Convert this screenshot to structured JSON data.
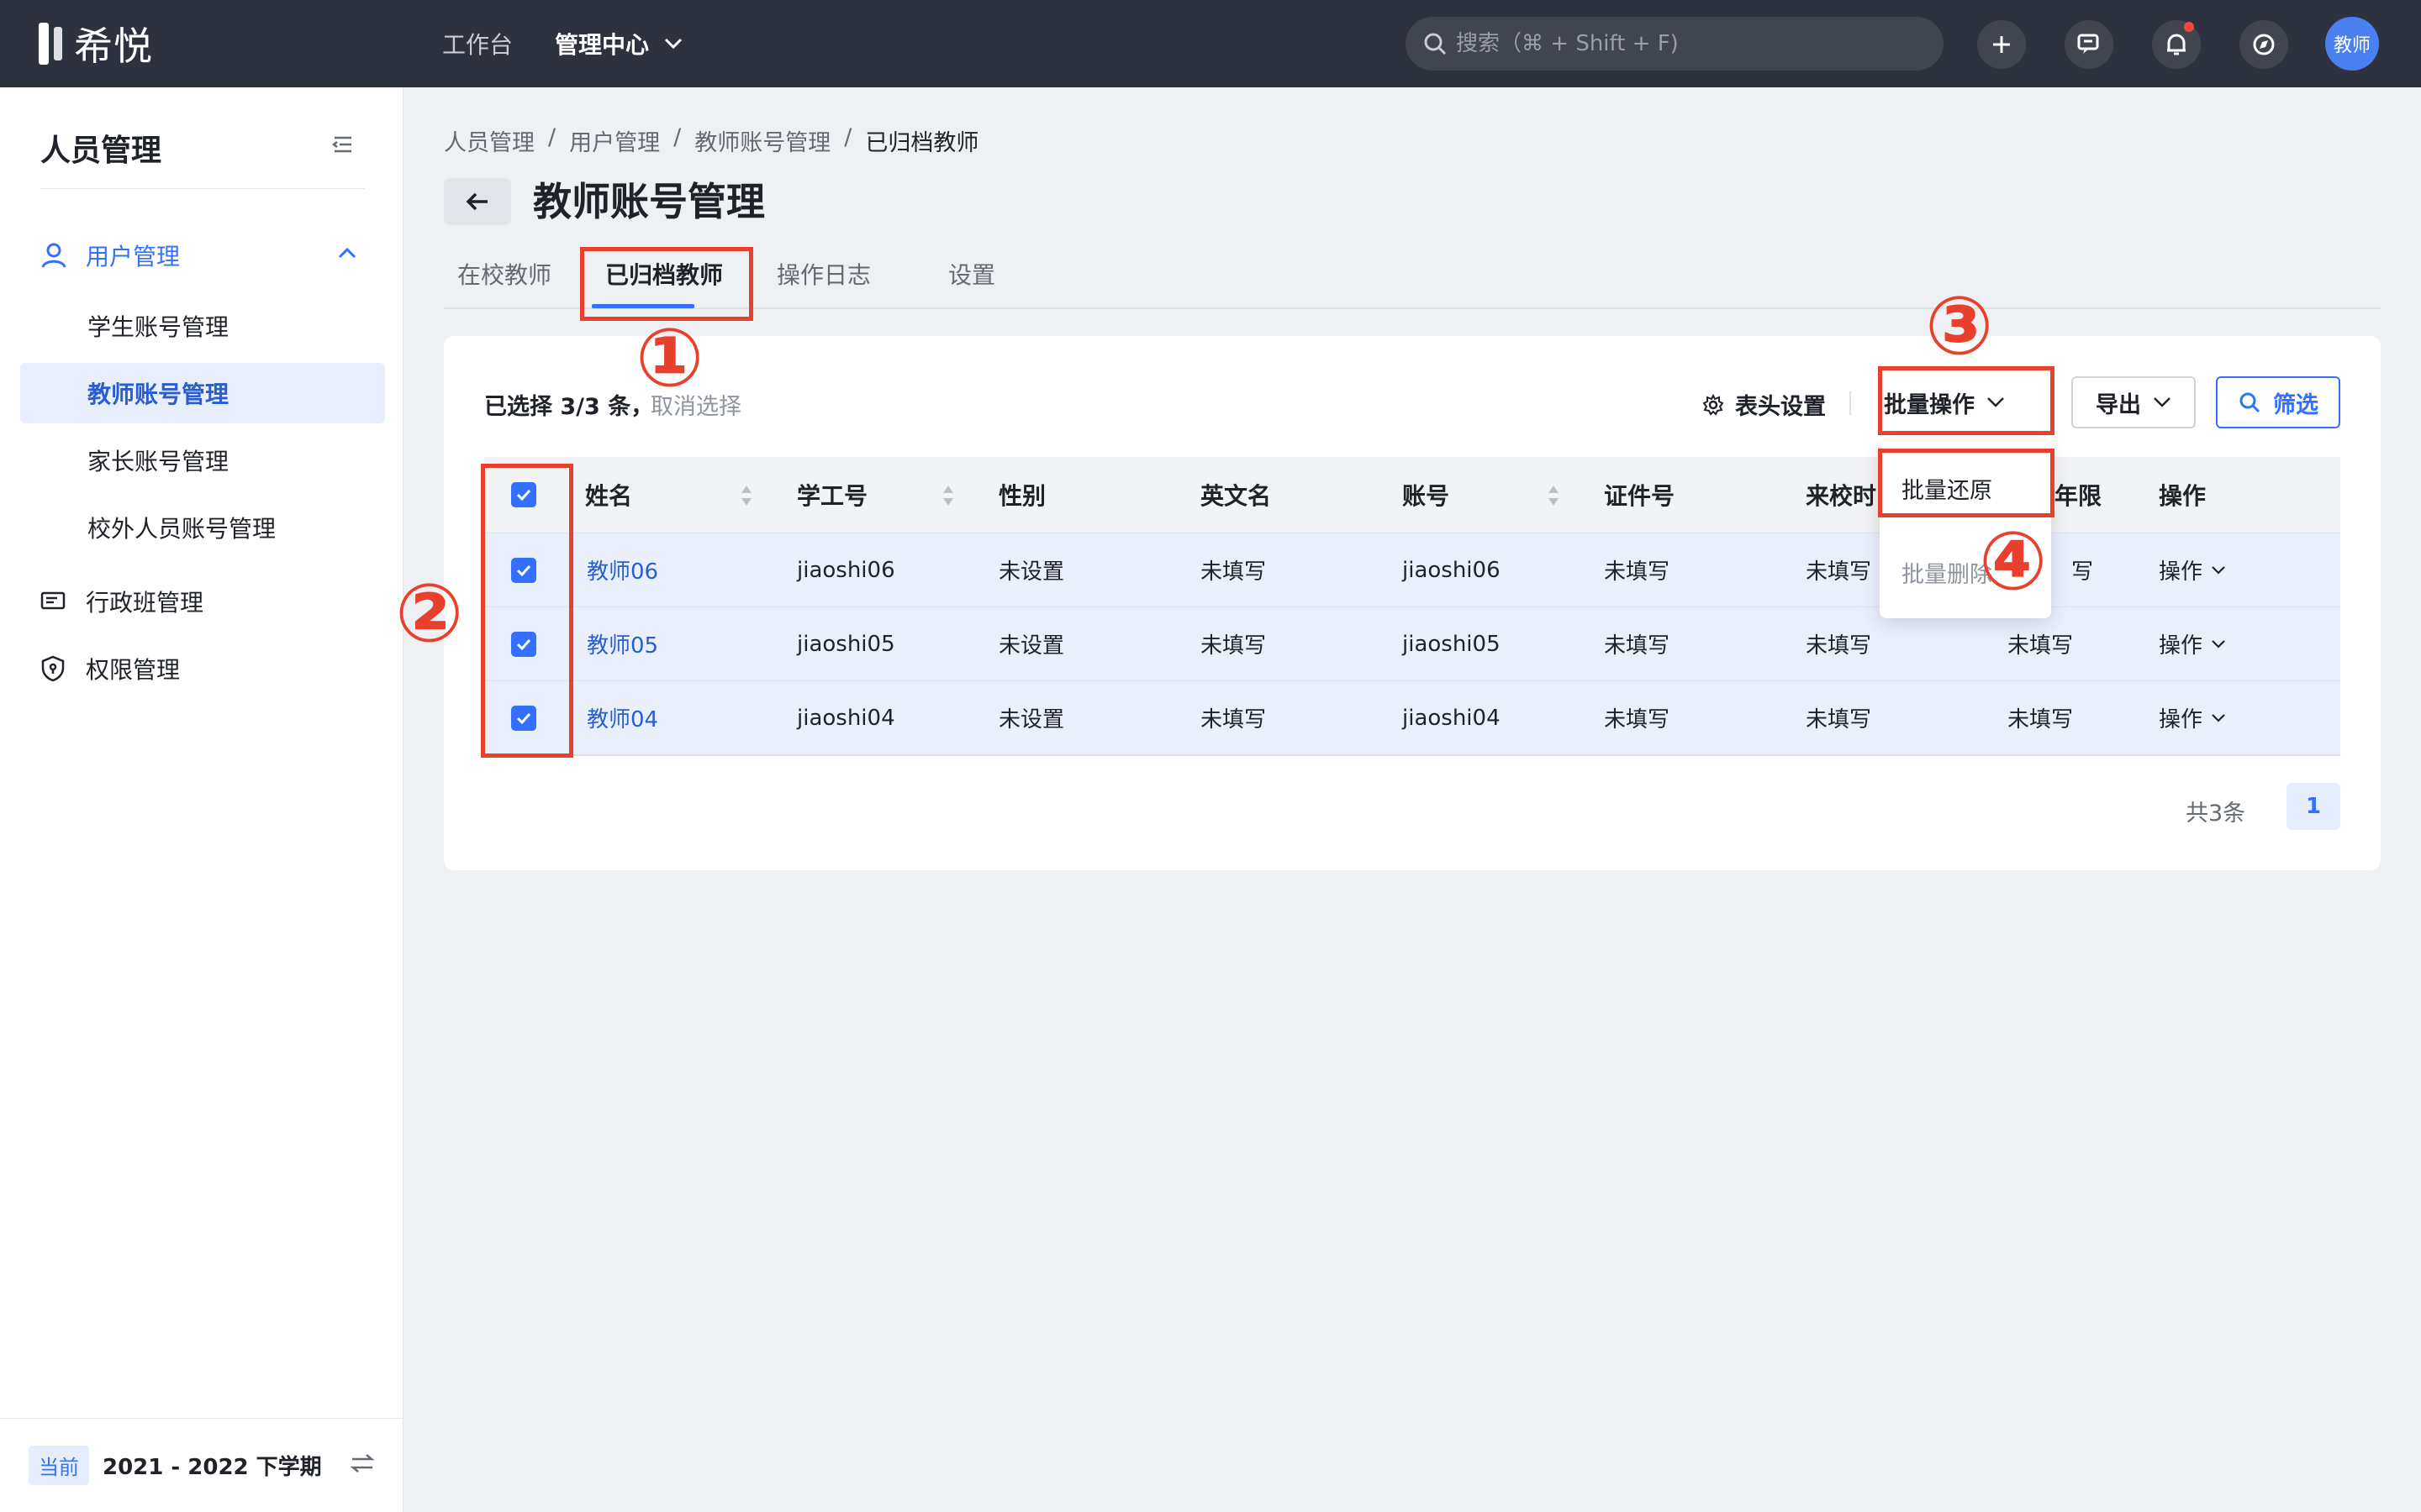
{
  "topbar": {
    "logo_text": "希悦",
    "nav": [
      "工作台",
      "管理中心"
    ],
    "search_placeholder": "搜索（⌘ + Shift + F)",
    "avatar_text": "教师"
  },
  "sidebar": {
    "title": "人员管理",
    "group_label": "用户管理",
    "items": [
      "学生账号管理",
      "教师账号管理",
      "家长账号管理",
      "校外人员账号管理"
    ],
    "other_items": [
      "行政班管理",
      "权限管理"
    ],
    "term_tag": "当前",
    "term_text": "2021 - 2022 下学期"
  },
  "breadcrumb": [
    "人员管理",
    "用户管理",
    "教师账号管理",
    "已归档教师"
  ],
  "breadcrumb_sep": "/",
  "page_title": "教师账号管理",
  "tabs": [
    "在校教师",
    "已归档教师",
    "操作日志",
    "设置"
  ],
  "toolbar": {
    "selected_text": "已选择 3/3 条，",
    "cancel_select": "取消选择",
    "header_settings": "表头设置",
    "batch_ops": "批量操作",
    "export": "导出",
    "filter": "筛选"
  },
  "dropdown": {
    "items": [
      "批量还原",
      "批量删除"
    ]
  },
  "table": {
    "headers": [
      "姓名",
      "学工号",
      "性别",
      "英文名",
      "账号",
      "证件号",
      "来校时",
      "年限",
      "操作"
    ],
    "rows": [
      {
        "name": "教师06",
        "id": "jiaoshi06",
        "gender": "未设置",
        "en": "未填写",
        "account": "jiaoshi06",
        "cert": "未填写",
        "join": "未填写",
        "years": "写",
        "op": "操作"
      },
      {
        "name": "教师05",
        "id": "jiaoshi05",
        "gender": "未设置",
        "en": "未填写",
        "account": "jiaoshi05",
        "cert": "未填写",
        "join": "未填写",
        "years": "未填写",
        "op": "操作"
      },
      {
        "name": "教师04",
        "id": "jiaoshi04",
        "gender": "未设置",
        "en": "未填写",
        "account": "jiaoshi04",
        "cert": "未填写",
        "join": "未填写",
        "years": "未填写",
        "op": "操作"
      }
    ]
  },
  "pagination": {
    "total": "共3条",
    "page": "1"
  },
  "annotations": [
    "①",
    "②",
    "③",
    "④"
  ],
  "colors": {
    "accent": "#3370ff",
    "annotation": "#e8402c",
    "topbar": "#2e323e"
  }
}
